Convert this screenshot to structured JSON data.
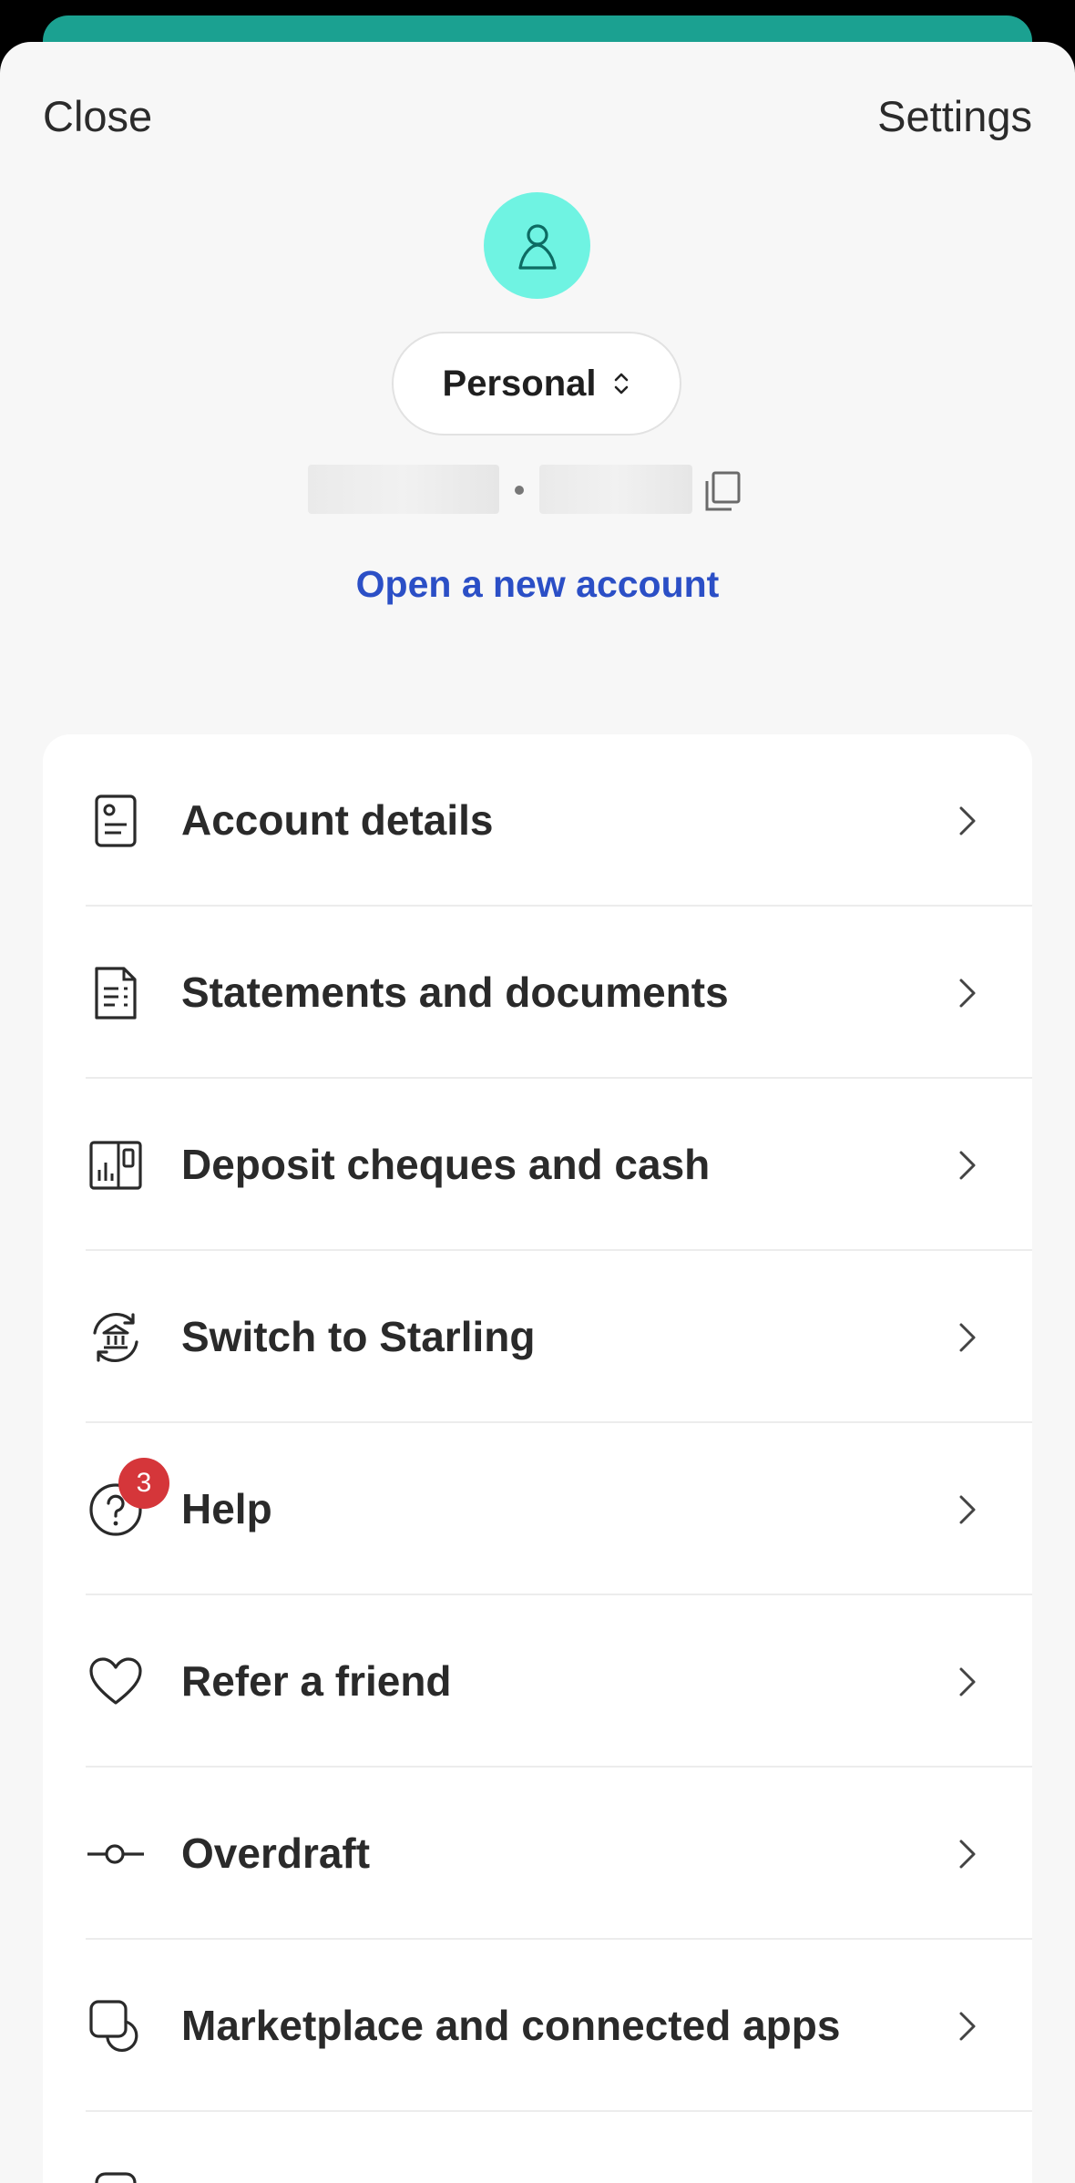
{
  "header": {
    "close_label": "Close",
    "settings_label": "Settings"
  },
  "account": {
    "avatar_icon": "person-icon",
    "switcher_label": "Personal",
    "switcher_icon": "chevron-up-down-icon",
    "open_new_account_label": "Open a new account"
  },
  "menu": {
    "items": [
      {
        "label": "Account details",
        "icon": "document-card-icon"
      },
      {
        "label": "Statements and documents",
        "icon": "statement-icon"
      },
      {
        "label": "Deposit cheques and cash",
        "icon": "deposit-icon"
      },
      {
        "label": "Switch to Starling",
        "icon": "bank-switch-icon"
      },
      {
        "label": "Help",
        "icon": "help-icon",
        "badge": "3"
      },
      {
        "label": "Refer a friend",
        "icon": "heart-icon"
      },
      {
        "label": "Overdraft",
        "icon": "overdraft-icon"
      },
      {
        "label": "Marketplace and connected apps",
        "icon": "marketplace-icon"
      }
    ]
  },
  "colors": {
    "accent_teal": "#1ba191",
    "avatar_bg": "#6ff3e2",
    "link_blue": "#2b4fc6",
    "badge_red": "#d5363a"
  }
}
